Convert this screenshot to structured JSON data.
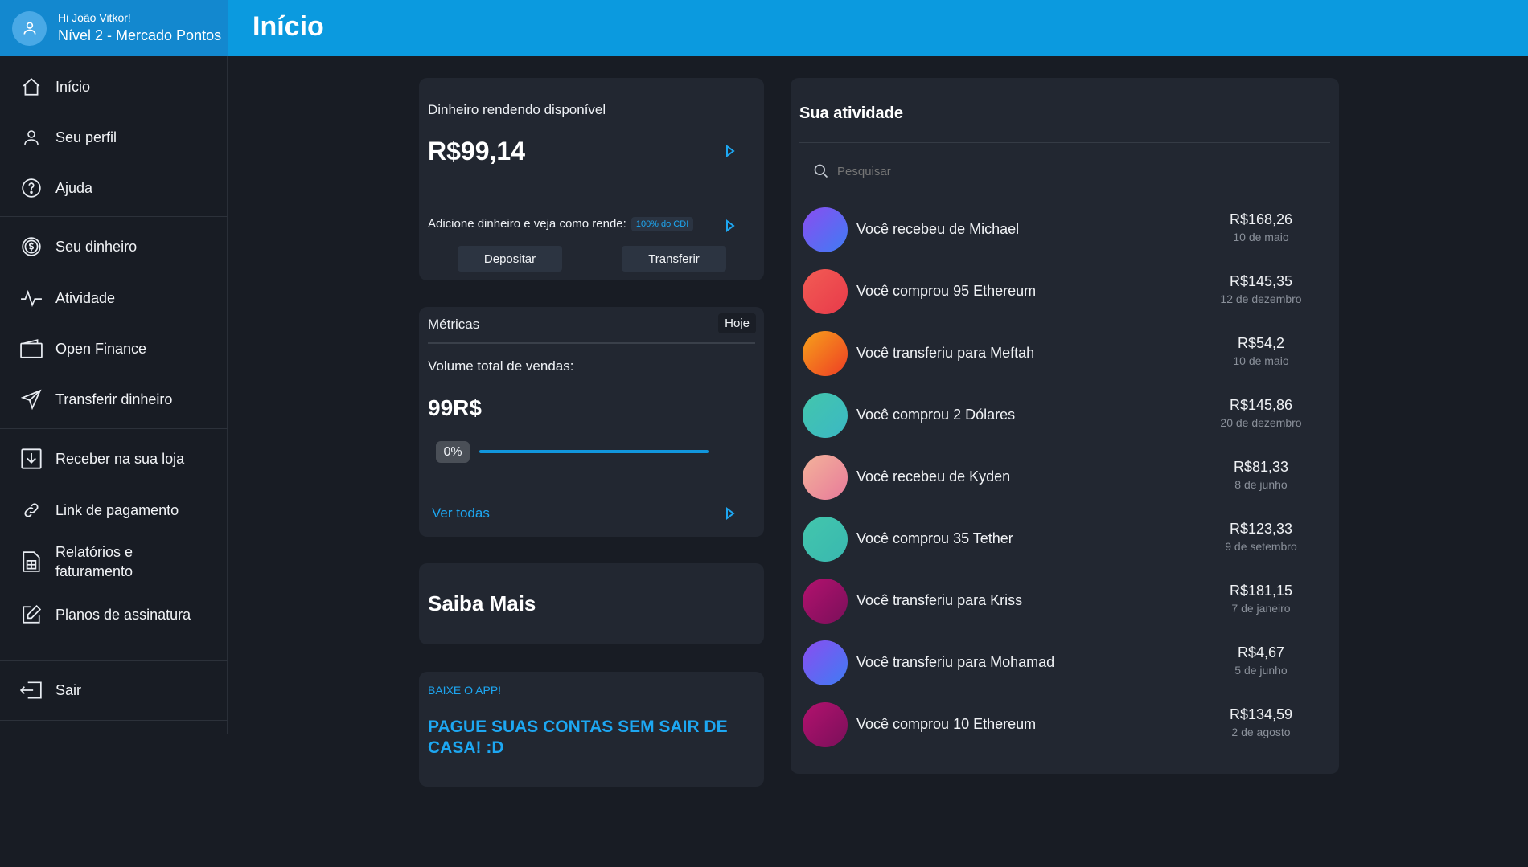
{
  "header": {
    "greeting": "Hi João Vitkor!",
    "level": "Nível 2 - Mercado Pontos",
    "page_title": "Início"
  },
  "sidebar": {
    "items": [
      {
        "label": "Início",
        "icon": "home-icon"
      },
      {
        "label": "Seu perfil",
        "icon": "user-icon"
      },
      {
        "label": "Ajuda",
        "icon": "help-icon"
      },
      {
        "label": "Seu dinheiro",
        "icon": "dollar-icon"
      },
      {
        "label": "Atividade",
        "icon": "activity-icon"
      },
      {
        "label": "Open Finance",
        "icon": "wallet-icon"
      },
      {
        "label": "Transferir dinheiro",
        "icon": "send-icon"
      },
      {
        "label": "Receber na sua loja",
        "icon": "download-icon"
      },
      {
        "label": "Link de pagamento",
        "icon": "link-icon"
      },
      {
        "label": "Relatórios e faturamento",
        "icon": "report-icon"
      },
      {
        "label": "Planos de assinatura",
        "icon": "edit-icon"
      },
      {
        "label": "Sair",
        "icon": "logout-icon"
      }
    ]
  },
  "balance_card": {
    "title": "Dinheiro rendendo disponível",
    "amount": "R$99,14",
    "promo_text": "Adicione dinheiro e veja como rende:",
    "badge": "100% do CDI",
    "deposit_label": "Depositar",
    "transfer_label": "Transferir"
  },
  "metrics_card": {
    "title": "Métricas",
    "period": "Hoje",
    "subtitle": "Volume total de vendas:",
    "value": "99R$",
    "progress_label": "0%",
    "see_all": "Ver todas"
  },
  "saiba_mais": {
    "title": "Saiba Mais"
  },
  "app_card": {
    "overline": "BAIXE O APP!",
    "headline": "PAGUE SUAS CONTAS SEM SAIR DE CASA! :D"
  },
  "activity": {
    "title": "Sua atividade",
    "search_placeholder": "Pesquisar",
    "items": [
      {
        "text": "Você recebeu de Michael",
        "amount": "R$168,26",
        "date": "10 de maio",
        "gradient": [
          "#8a4df0",
          "#3f7cf4"
        ]
      },
      {
        "text": "Você comprou 95 Ethereum",
        "amount": "R$145,35",
        "date": "12 de dezembro",
        "gradient": [
          "#f25c54",
          "#e83a4a"
        ]
      },
      {
        "text": "Você transferiu para Meftah",
        "amount": "R$54,2",
        "date": "10 de maio",
        "gradient": [
          "#f7a21b",
          "#ee3d24"
        ]
      },
      {
        "text": "Você comprou 2 Dólares",
        "amount": "R$145,86",
        "date": "20 de dezembro",
        "gradient": [
          "#43c6ac",
          "#3bb8c4"
        ]
      },
      {
        "text": "Você recebeu de Kyden",
        "amount": "R$81,33",
        "date": "8 de junho",
        "gradient": [
          "#f3b39a",
          "#e87a9a"
        ]
      },
      {
        "text": "Você comprou 35 Tether",
        "amount": "R$123,33",
        "date": "9 de setembro",
        "gradient": [
          "#43c6ac",
          "#39b8b0"
        ]
      },
      {
        "text": "Você transferiu para Kriss",
        "amount": "R$181,15",
        "date": "7 de janeiro",
        "gradient": [
          "#b3126e",
          "#7a0f5a"
        ]
      },
      {
        "text": "Você transferiu para Mohamad",
        "amount": "R$4,67",
        "date": "5 de junho",
        "gradient": [
          "#8a4df0",
          "#3f7cf4"
        ]
      },
      {
        "text": "Você comprou 10 Ethereum",
        "amount": "R$134,59",
        "date": "2 de agosto",
        "gradient": [
          "#b3126e",
          "#7a0f5a"
        ]
      }
    ]
  },
  "colors": {
    "header_bg": "#0b9adf",
    "user_box_bg": "#1388cf",
    "page_bg": "#181c24",
    "card_bg": "#222731",
    "accent": "#1da7f2"
  }
}
